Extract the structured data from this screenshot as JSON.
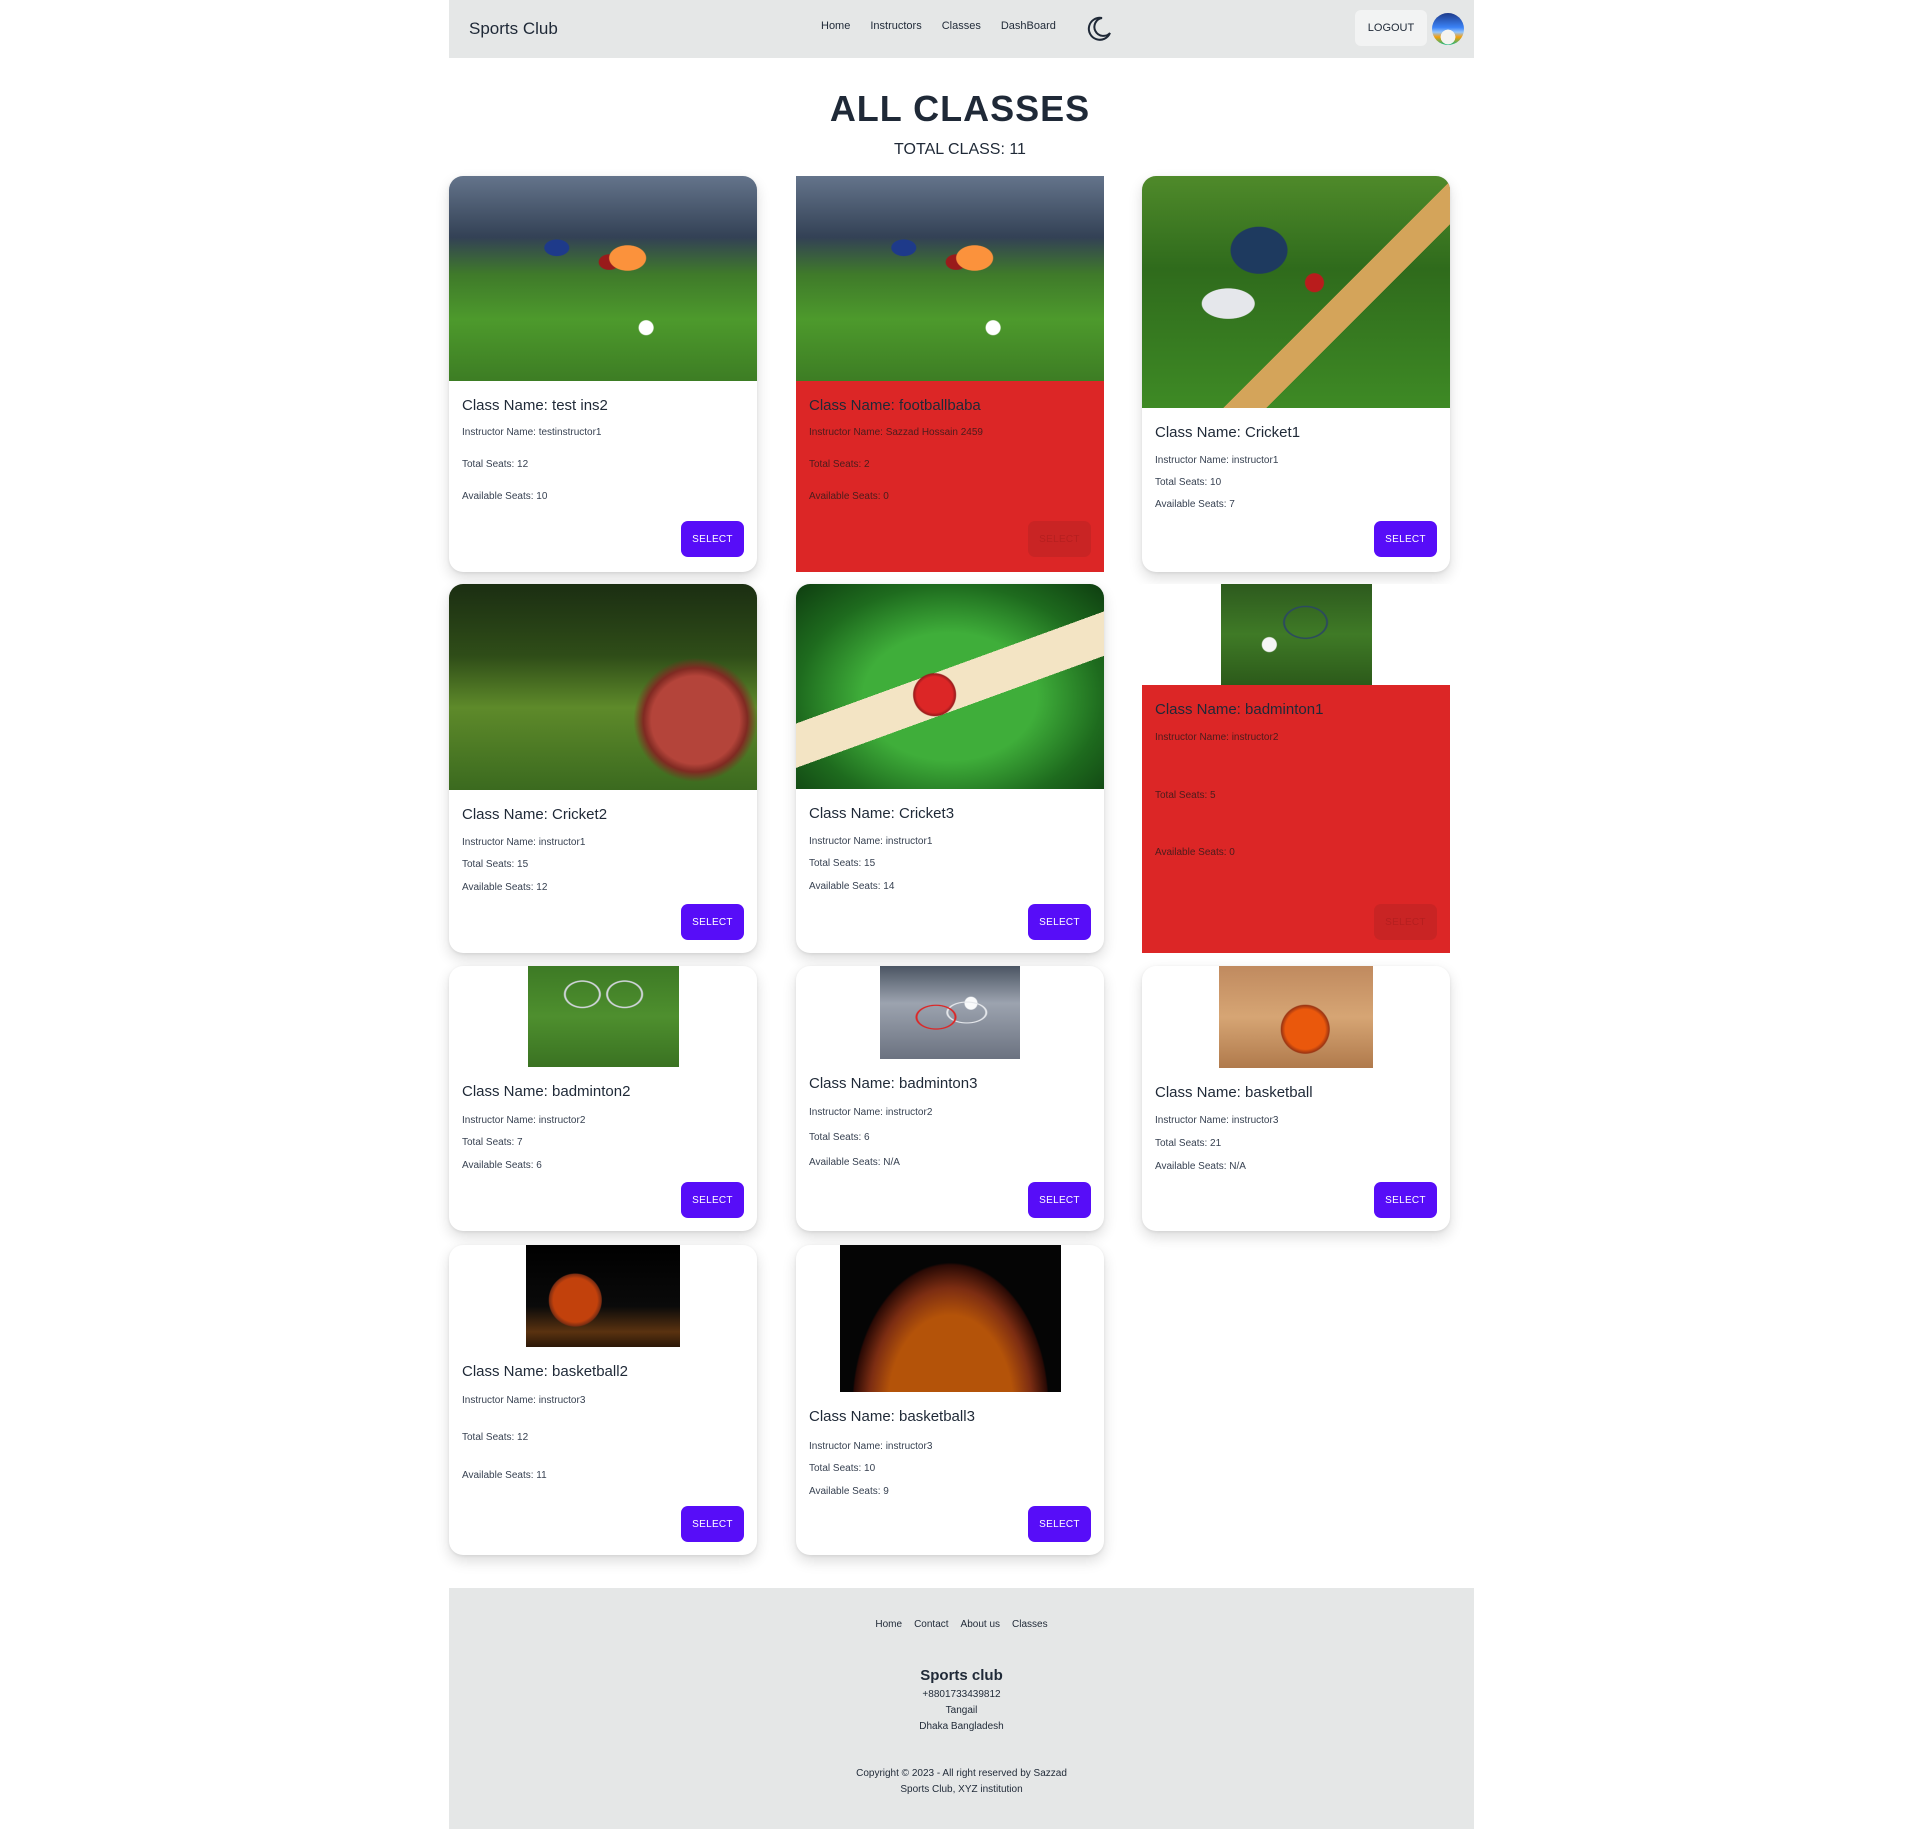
{
  "navbar": {
    "brand": "Sports Club",
    "links": [
      "Home",
      "Instructors",
      "Classes",
      "DashBoard"
    ],
    "theme_icon": "moon-icon",
    "logout_label": "LOGOUT"
  },
  "header": {
    "title": "ALL CLASSES",
    "subtitle": "TOTAL CLASS: 11"
  },
  "cards": [
    {
      "name": "Class Name: test ins2",
      "instructor": "Instructor Name: testinstructor1",
      "total": "Total Seats: 12",
      "available": "Available Seats: 10",
      "full": false
    },
    {
      "name": "Class Name: footballbaba",
      "instructor": "Instructor Name: Sazzad Hossain 2459",
      "total": "Total Seats: 2",
      "available": "Available Seats: 0",
      "full": true
    },
    {
      "name": "Class Name: Cricket1",
      "instructor": "Instructor Name: instructor1",
      "total": "Total Seats: 10",
      "available": "Available Seats: 7",
      "full": false
    },
    {
      "name": "Class Name: Cricket2",
      "instructor": "Instructor Name: instructor1",
      "total": "Total Seats: 15",
      "available": "Available Seats: 12",
      "full": false
    },
    {
      "name": "Class Name: Cricket3",
      "instructor": "Instructor Name: instructor1",
      "total": "Total Seats: 15",
      "available": "Available Seats: 14",
      "full": false
    },
    {
      "name": "Class Name: badminton1",
      "instructor": "Instructor Name: instructor2",
      "total": "Total Seats: 5",
      "available": "Available Seats: 0",
      "full": true
    },
    {
      "name": "Class Name: badminton2",
      "instructor": "Instructor Name: instructor2",
      "total": "Total Seats: 7",
      "available": "Available Seats: 6",
      "full": false
    },
    {
      "name": "Class Name: badminton3",
      "instructor": "Instructor Name: instructor2",
      "total": "Total Seats: 6",
      "available": "Available Seats: N/A",
      "full": false
    },
    {
      "name": "Class Name: basketball",
      "instructor": "Instructor Name: instructor3",
      "total": "Total Seats: 21",
      "available": "Available Seats: N/A",
      "full": false
    },
    {
      "name": "Class Name: basketball2",
      "instructor": "Instructor Name: instructor3",
      "total": "Total Seats: 12",
      "available": "Available Seats: 11",
      "full": false
    },
    {
      "name": "Class Name: basketball3",
      "instructor": "Instructor Name: instructor3",
      "total": "Total Seats: 10",
      "available": "Available Seats: 9",
      "full": false
    }
  ],
  "select_label": "SELECT",
  "colors": {
    "primary": "#570df8",
    "full_card": "#dc2626",
    "nav_bg": "#e5e7e7"
  },
  "footer": {
    "links": [
      "Home",
      "Contact",
      "About us",
      "Classes"
    ],
    "title": "Sports club",
    "phone": "+8801733439812",
    "city": "Tangail",
    "region": "Dhaka Bangladesh",
    "copyright": "Copyright © 2023 - All right reserved by Sazzad",
    "org": "Sports Club, XYZ institution"
  }
}
